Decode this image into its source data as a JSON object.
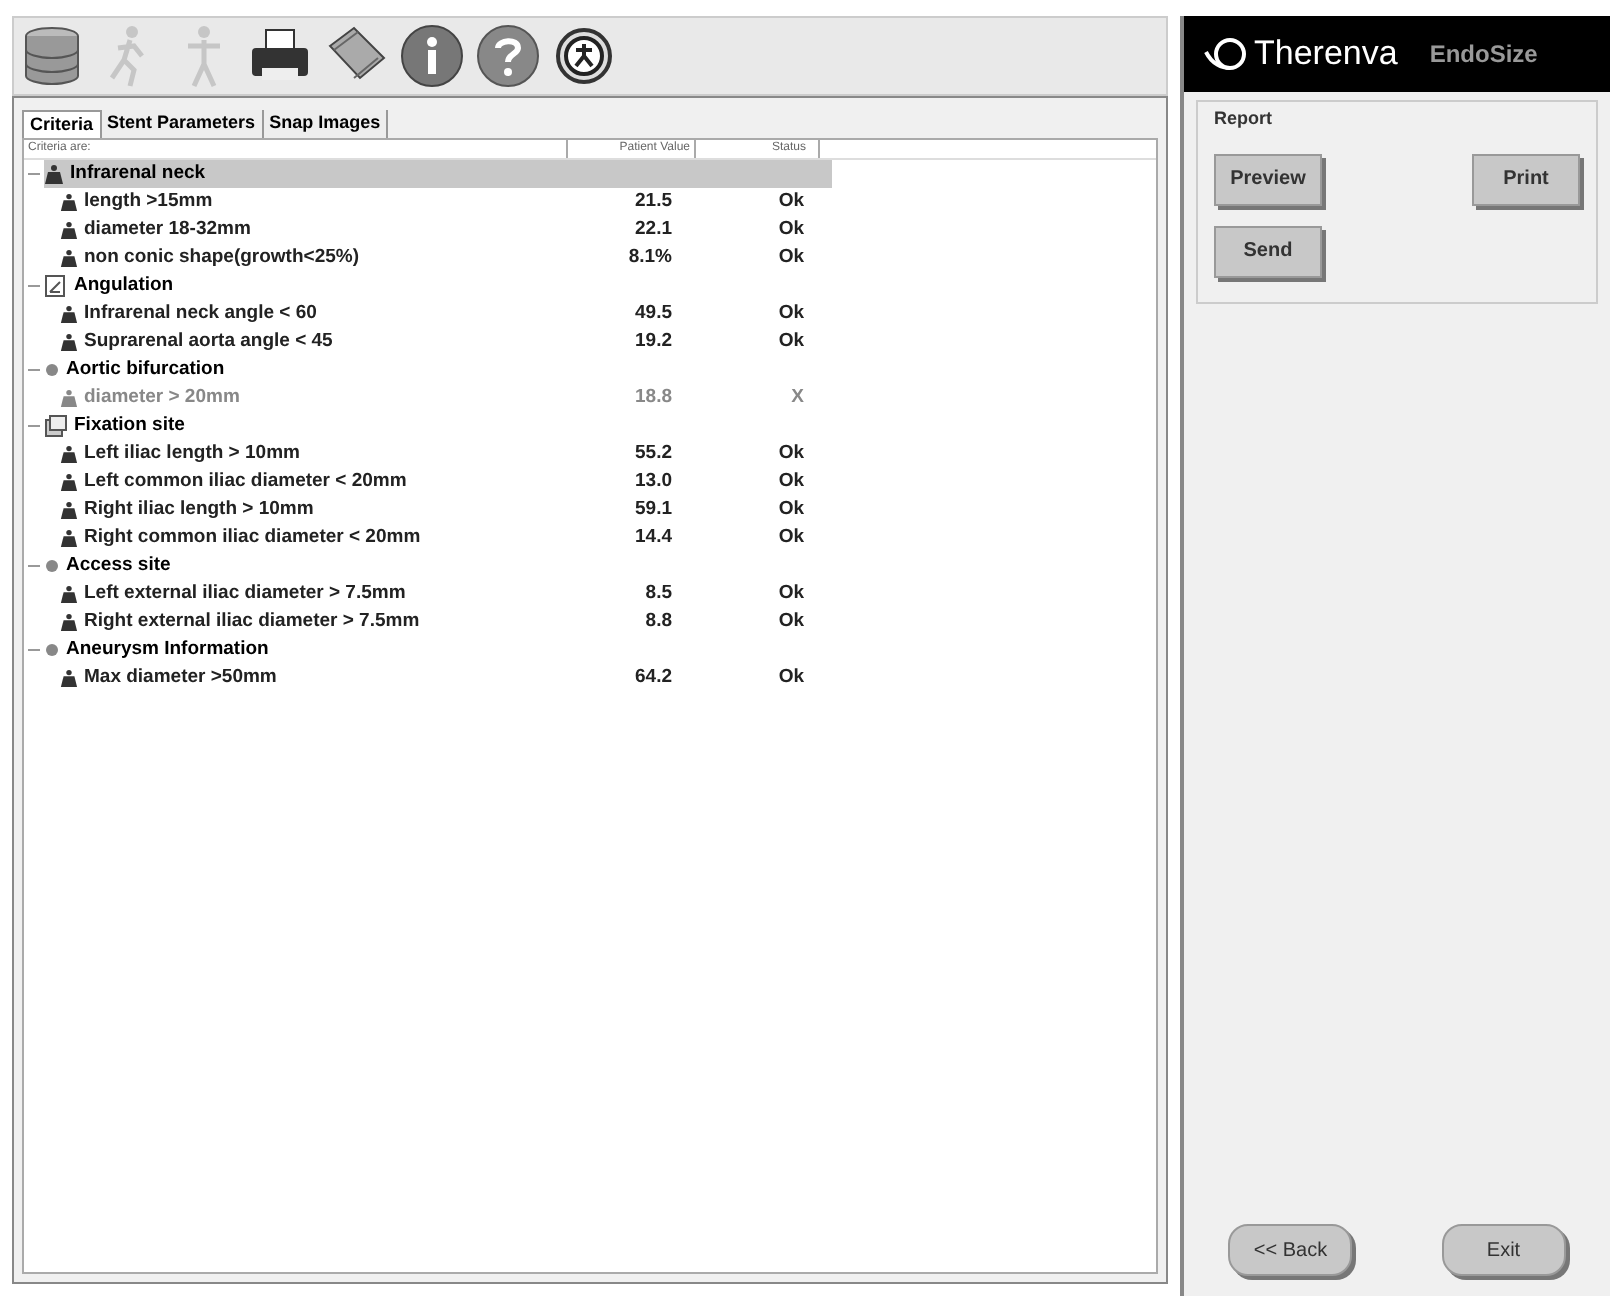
{
  "toolbar": [
    {
      "kind": "database",
      "disabled": false
    },
    {
      "kind": "runner",
      "disabled": true
    },
    {
      "kind": "figure",
      "disabled": true
    },
    {
      "kind": "printer",
      "disabled": false
    },
    {
      "kind": "ruler",
      "disabled": false
    },
    {
      "kind": "info",
      "disabled": false
    },
    {
      "kind": "help",
      "disabled": false
    },
    {
      "kind": "exit",
      "disabled": false
    }
  ],
  "brand": {
    "name": "Therenva",
    "product": "EndoSize"
  },
  "tabs": [
    {
      "label": "Criteria",
      "selected": true
    },
    {
      "label": "Stent Parameters",
      "selected": false
    },
    {
      "label": "Snap Images",
      "selected": false
    }
  ],
  "columns": [
    "Criteria are:",
    "Patient Value",
    "Status"
  ],
  "groups": [
    {
      "label": "Infrarenal neck",
      "kind": "weight",
      "selected": true,
      "expanded": true,
      "children": [
        {
          "label": "length >15mm",
          "value": "21.5",
          "status": "Ok",
          "met": true
        },
        {
          "label": "diameter 18-32mm",
          "value": "22.1",
          "status": "Ok",
          "met": true
        },
        {
          "label": "non conic shape(growth<25%)",
          "value": "8.1%",
          "status": "Ok",
          "met": true
        }
      ]
    },
    {
      "label": "Angulation",
      "kind": "angle",
      "selected": false,
      "expanded": true,
      "children": [
        {
          "label": "Infrarenal neck angle < 60",
          "value": "49.5",
          "status": "Ok",
          "met": true
        },
        {
          "label": "Suprarenal aorta angle < 45",
          "value": "19.2",
          "status": "Ok",
          "met": true
        }
      ]
    },
    {
      "label": "Aortic bifurcation",
      "kind": "dot",
      "selected": false,
      "expanded": true,
      "children": [
        {
          "label": "diameter > 20mm",
          "value": "18.8",
          "status": "X",
          "met": false
        }
      ]
    },
    {
      "label": "Fixation site",
      "kind": "stack",
      "selected": false,
      "expanded": true,
      "children": [
        {
          "label": "Left iliac length > 10mm",
          "value": "55.2",
          "status": "Ok",
          "met": true
        },
        {
          "label": "Left common iliac diameter < 20mm",
          "value": "13.0",
          "status": "Ok",
          "met": true
        },
        {
          "label": "Right iliac length > 10mm",
          "value": "59.1",
          "status": "Ok",
          "met": true
        },
        {
          "label": "Right common iliac diameter < 20mm",
          "value": "14.4",
          "status": "Ok",
          "met": true
        }
      ]
    },
    {
      "label": "Access site",
      "kind": "dot",
      "selected": false,
      "expanded": true,
      "children": [
        {
          "label": "Left external iliac diameter > 7.5mm",
          "value": "8.5",
          "status": "Ok",
          "met": true
        },
        {
          "label": "Right external iliac diameter > 7.5mm",
          "value": "8.8",
          "status": "Ok",
          "met": true
        }
      ]
    },
    {
      "label": "Aneurysm Information",
      "kind": "dot",
      "selected": false,
      "expanded": true,
      "children": [
        {
          "label": "Max diameter >50mm",
          "value": "64.2",
          "status": "Ok",
          "met": true
        }
      ]
    }
  ],
  "report": {
    "title": "Report",
    "buttons": [
      "Preview",
      "Print",
      "Send"
    ]
  },
  "nav_buttons": [
    "<< Back",
    "Exit"
  ]
}
